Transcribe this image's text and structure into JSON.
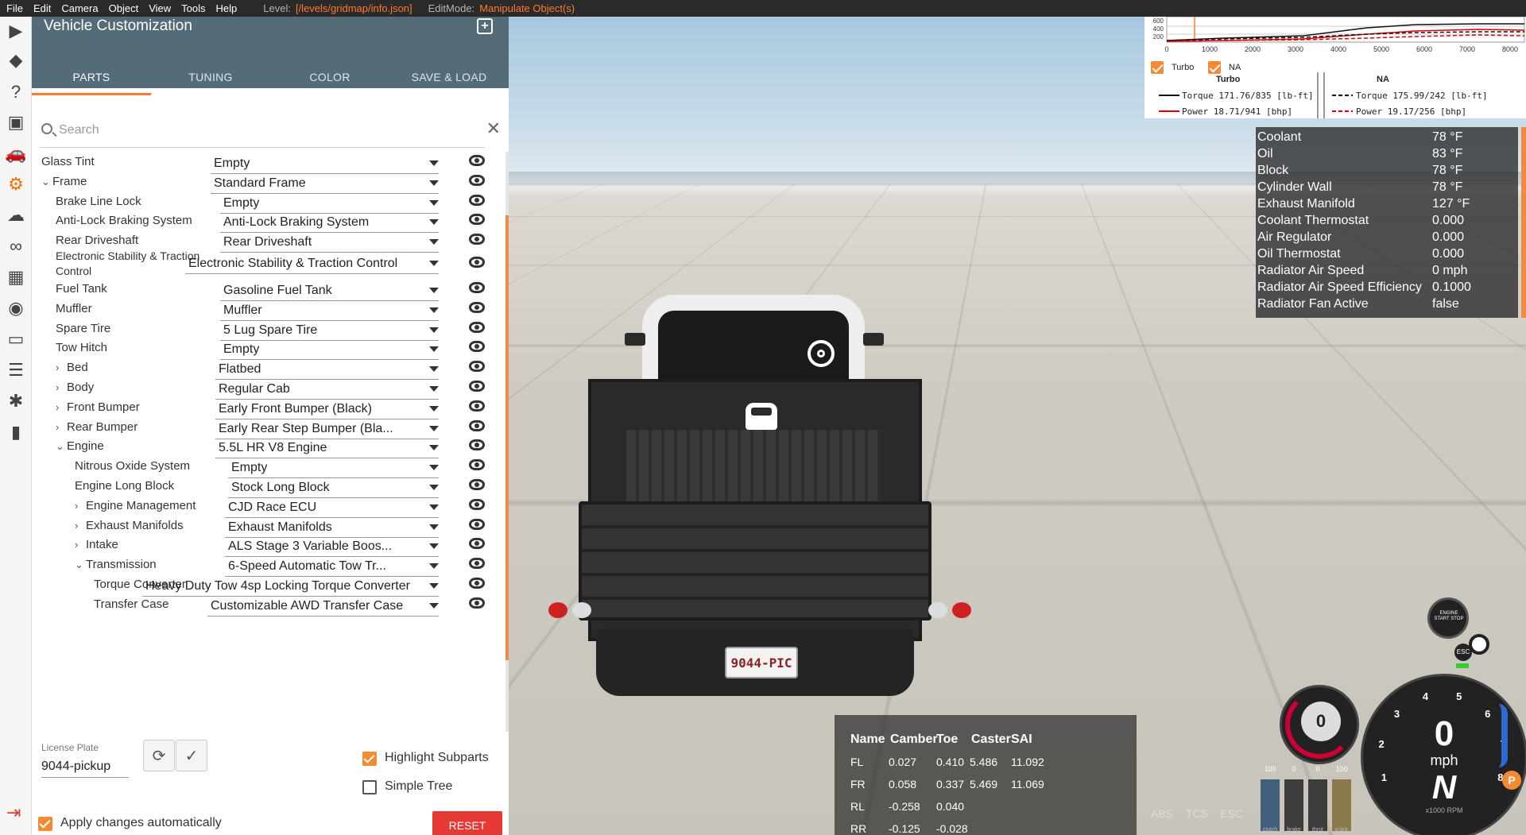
{
  "menu": {
    "items": [
      "File",
      "Edit",
      "Camera",
      "Object",
      "View",
      "Tools",
      "Help"
    ],
    "level_label": "Level:",
    "level_value": "[/levels/gridmap/info.json]",
    "editmode_label": "EditMode:",
    "editmode_value": "Manipulate Object(s)"
  },
  "panel": {
    "title": "Vehicle Customization",
    "tabs": [
      "PARTS",
      "TUNING",
      "COLOR",
      "SAVE & LOAD"
    ],
    "active_tab": "PARTS",
    "search_placeholder": "Search",
    "parts": [
      {
        "name": "Glass Tint",
        "value": "Empty",
        "indent": 0,
        "chev": ""
      },
      {
        "name": "Frame",
        "value": "Standard Frame",
        "indent": 0,
        "chev": "v"
      },
      {
        "name": "Brake Line Lock",
        "value": "Empty",
        "indent": 1,
        "chev": ""
      },
      {
        "name": "Anti-Lock Braking System",
        "value": "Anti-Lock Braking System",
        "indent": 1,
        "chev": ""
      },
      {
        "name": "Rear Driveshaft",
        "value": "Rear Driveshaft",
        "indent": 1,
        "chev": ""
      },
      {
        "name": "Electronic Stability & Traction Control",
        "value": "Electronic Stability & Traction Control",
        "indent": 1,
        "chev": ""
      },
      {
        "name": "Fuel Tank",
        "value": "Gasoline Fuel Tank",
        "indent": 1,
        "chev": ""
      },
      {
        "name": "Muffler",
        "value": "Muffler",
        "indent": 1,
        "chev": ""
      },
      {
        "name": "Spare Tire",
        "value": "5 Lug Spare Tire",
        "indent": 1,
        "chev": ""
      },
      {
        "name": "Tow Hitch",
        "value": "Empty",
        "indent": 1,
        "chev": ""
      },
      {
        "name": "Bed",
        "value": "Flatbed",
        "indent": 1,
        "chev": ">"
      },
      {
        "name": "Body",
        "value": "Regular Cab",
        "indent": 1,
        "chev": ">"
      },
      {
        "name": "Front Bumper",
        "value": "Early Front Bumper (Black)",
        "indent": 1,
        "chev": ">"
      },
      {
        "name": "Rear Bumper",
        "value": "Early Rear Step Bumper (Bla...",
        "indent": 1,
        "chev": ">"
      },
      {
        "name": "Engine",
        "value": "5.5L HR V8 Engine",
        "indent": 1,
        "chev": "v"
      },
      {
        "name": "Nitrous Oxide System",
        "value": "Empty",
        "indent": 2,
        "chev": ""
      },
      {
        "name": "Engine Long Block",
        "value": "Stock Long Block",
        "indent": 2,
        "chev": ""
      },
      {
        "name": "Engine Management",
        "value": "CJD Race ECU",
        "indent": 2,
        "chev": ">"
      },
      {
        "name": "Exhaust Manifolds",
        "value": "Exhaust Manifolds",
        "indent": 2,
        "chev": ">"
      },
      {
        "name": "Intake",
        "value": "ALS Stage 3 Variable Boos...",
        "indent": 2,
        "chev": ">"
      },
      {
        "name": "Transmission",
        "value": "6-Speed Automatic Tow Tr...",
        "indent": 2,
        "chev": "v"
      },
      {
        "name": "Torque Converter",
        "value": "Heavy Duty Tow 4sp Locking Torque Converter",
        "indent": 3,
        "chev": ""
      },
      {
        "name": "Transfer Case",
        "value": "Customizable AWD Transfer Case",
        "indent": 3,
        "chev": ""
      }
    ],
    "license_plate_label": "License Plate",
    "license_plate_value": "9044-pickup",
    "highlight_subparts": "Highlight Subparts",
    "simple_tree": "Simple Tree",
    "apply_auto": "Apply changes automatically",
    "reset": "RESET"
  },
  "torque_widget": {
    "x_ticks": [
      "0",
      "1000",
      "2000",
      "3000",
      "4000",
      "5000",
      "6000",
      "7000",
      "8000"
    ],
    "y_ticks": [
      "600",
      "400",
      "200"
    ],
    "turbo_label": "Turbo",
    "na_label": "NA",
    "turbo_title": "Turbo",
    "na_title": "NA",
    "turbo_torque": "Torque 171.76/835 [lb-ft]",
    "turbo_power": "Power  18.71/941  [bhp]",
    "na_torque": "Torque 175.99/242 [lb-ft]",
    "na_power": "Power  19.17/256  [bhp]"
  },
  "temperatures": [
    {
      "k": "Coolant",
      "v": "78 °F"
    },
    {
      "k": "Oil",
      "v": "83 °F"
    },
    {
      "k": "Block",
      "v": "78 °F"
    },
    {
      "k": "Cylinder Wall",
      "v": "78 °F"
    },
    {
      "k": "Exhaust Manifold",
      "v": "127 °F"
    },
    {
      "k": "Coolant Thermostat",
      "v": "0.000"
    },
    {
      "k": "Air Regulator",
      "v": "0.000"
    },
    {
      "k": "Oil Thermostat",
      "v": "0.000"
    },
    {
      "k": "Radiator Air Speed",
      "v": "0 mph"
    },
    {
      "k": "Radiator Air Speed Efficiency",
      "v": "0.1000"
    },
    {
      "k": "Radiator Fan Active",
      "v": "false"
    }
  ],
  "alignment": {
    "headers": [
      "Name",
      "Camber",
      "Toe",
      "Caster",
      "SAI"
    ],
    "rows": [
      [
        "FL",
        "0.027",
        "0.410",
        "5.486",
        "11.092"
      ],
      [
        "FR",
        "0.058",
        "0.337",
        "5.469",
        "11.069"
      ],
      [
        "RL",
        "-0.258",
        "0.040",
        "",
        ""
      ],
      [
        "RR",
        "-0.125",
        "-0.028",
        "",
        ""
      ]
    ]
  },
  "hud": {
    "abs": "ABS",
    "tcs": "TCS",
    "esc": "ESC",
    "speed": "0",
    "speed_unit": "mph",
    "gear": "N",
    "rpm_unit": "x1000 RPM",
    "small_gauge_value": "0",
    "pedals": [
      {
        "label": "clutch",
        "value": "100",
        "level": 1.0
      },
      {
        "label": "brake",
        "value": "0",
        "level": 0
      },
      {
        "label": "throt",
        "value": "0",
        "level": 0
      },
      {
        "label": "p-brk",
        "value": "100",
        "level": 1.0
      }
    ],
    "engine_button": "ENGINE START STOP",
    "rpm_ticks": [
      "1",
      "2",
      "3",
      "4",
      "5",
      "6",
      "7",
      "8"
    ],
    "plate_text": "9044-PIC"
  }
}
